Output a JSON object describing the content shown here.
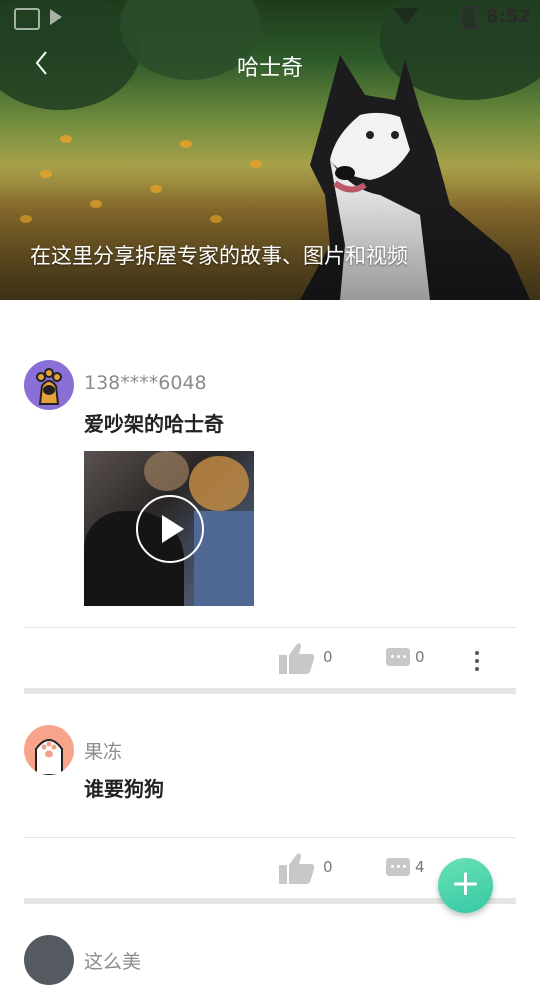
{
  "status_bar": {
    "time": "8:52"
  },
  "header": {
    "back_icon": "chevron-left-icon",
    "title": "哈士奇",
    "caption": "在这里分享拆屋专家的故事、图片和视频"
  },
  "posts": [
    {
      "username": "138****6048",
      "text": "爱吵架的哈士奇",
      "has_video": true,
      "likes": "0",
      "comments": "0"
    },
    {
      "username": "果冻",
      "text": "谁要狗狗",
      "likes": "0",
      "comments": "4"
    },
    {
      "username": "这么美"
    }
  ],
  "fab": {
    "label": "+",
    "color": "#3fd1aa"
  }
}
